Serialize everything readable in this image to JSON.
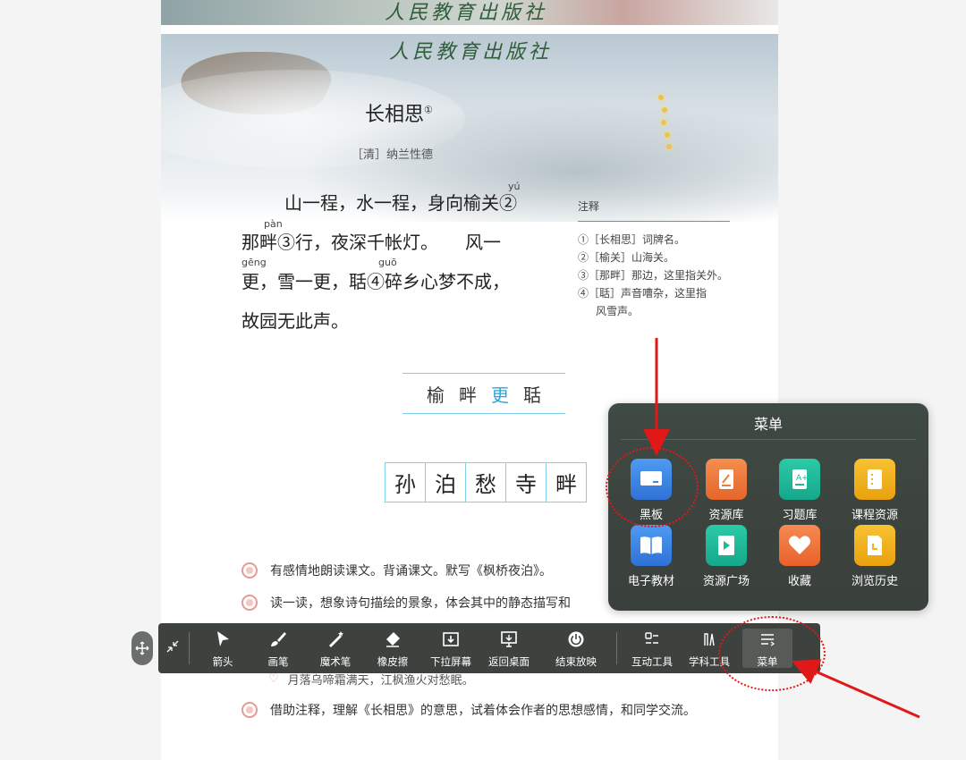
{
  "page": {
    "publisher_seal": "人民教育出版社",
    "poem_title": "长相思",
    "title_note": "①",
    "author": "［清］纳兰性德",
    "poem_lines": [
      "山一程，水一程，身向榆关②",
      "那畔③行，夜深千帐灯。　　风一",
      "更，雪一更，聒④碎乡心梦不成，",
      "故园无此声。"
    ],
    "pinyin": {
      "yu": "yú",
      "pan": "pàn",
      "geng": "gēng",
      "guo": "guō"
    },
    "notes_heading": "注释",
    "notes": [
      "①［长相思］词牌名。",
      "②［榆关］山海关。",
      "③［那畔］那边，这里指关外。",
      "④［聒］声音嘈杂，这里指",
      "风雪声。"
    ],
    "word_row": [
      "榆",
      "畔",
      "更",
      "聒"
    ],
    "char_grid": [
      "孙",
      "泊",
      "愁",
      "寺",
      "畔"
    ],
    "tasks": [
      "有感情地朗读课文。背诵课文。默写《枫桥夜泊》。",
      "读一读，想象诗句描绘的景象，体会其中的静态描写和",
      "月落乌啼霜满天，江枫渔火对愁眠。",
      "借助注释，理解《长相思》的意思，试着体会作者的思想感情，和同学交流。"
    ]
  },
  "menu": {
    "title": "菜单",
    "items": [
      {
        "label": "黑板",
        "icon": "blackboard-icon",
        "color": "#3b86e8"
      },
      {
        "label": "资源库",
        "icon": "resource-library-icon",
        "color": "#ee7a3a"
      },
      {
        "label": "习题库",
        "icon": "exercise-library-icon",
        "color": "#1fb79a"
      },
      {
        "label": "课程资源",
        "icon": "course-resource-icon",
        "color": "#f1b21e"
      },
      {
        "label": "电子教材",
        "icon": "ebook-icon",
        "color": "#3b86e8"
      },
      {
        "label": "资源广场",
        "icon": "resource-plaza-icon",
        "color": "#1fb79a"
      },
      {
        "label": "收藏",
        "icon": "favorite-heart-icon",
        "color": "#f0723f"
      },
      {
        "label": "浏览历史",
        "icon": "browse-history-icon",
        "color": "#f1b21e"
      }
    ]
  },
  "toolbar": {
    "items": [
      {
        "label": "箭头",
        "icon": "arrow-pointer-icon"
      },
      {
        "label": "画笔",
        "icon": "brush-icon"
      },
      {
        "label": "魔术笔",
        "icon": "magic-pen-icon"
      },
      {
        "label": "橡皮擦",
        "icon": "eraser-icon"
      },
      {
        "label": "下拉屏幕",
        "icon": "pull-down-screen-icon"
      },
      {
        "label": "返回桌面",
        "icon": "return-desktop-icon"
      },
      {
        "label": "结束放映",
        "icon": "end-show-icon"
      },
      {
        "label": "互动工具",
        "icon": "interactive-tools-icon"
      },
      {
        "label": "学科工具",
        "icon": "subject-tools-icon"
      },
      {
        "label": "菜单",
        "icon": "menu-icon"
      }
    ]
  },
  "colors": {
    "accent_annotation": "#e11818",
    "toolbar_bg": "#3d423f",
    "highlight_text": "#2aa7d8"
  }
}
